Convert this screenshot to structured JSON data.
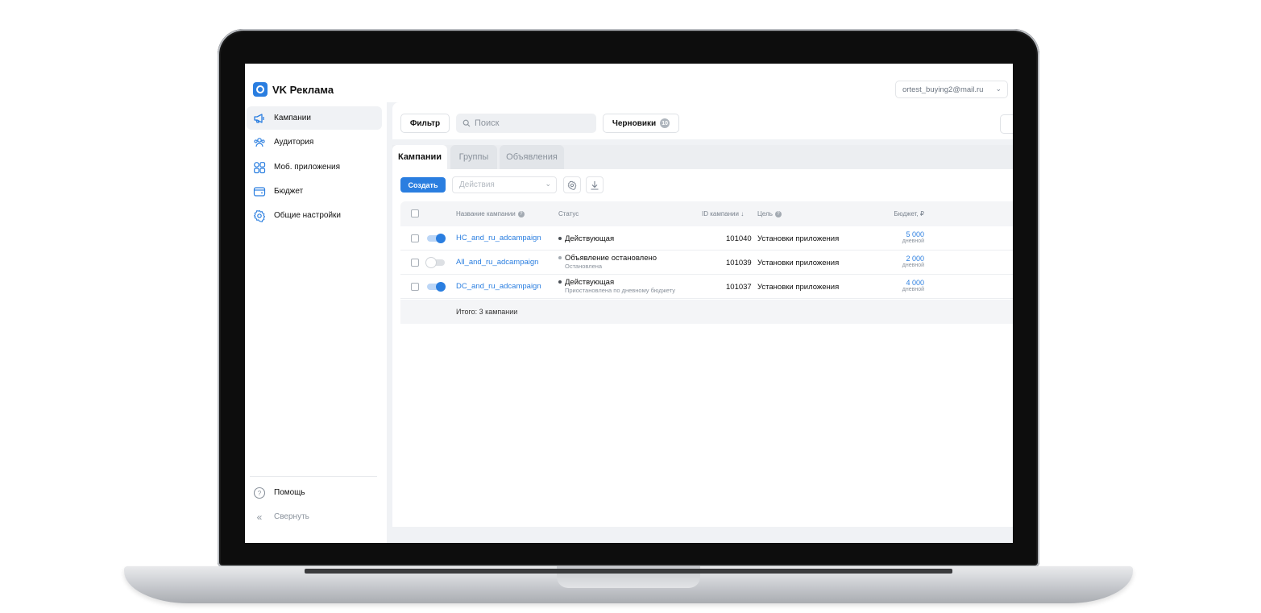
{
  "app": {
    "logo_text": "VK Реклама",
    "account_email": "ortest_buying2@mail.ru",
    "accent": "#2a7ee0"
  },
  "sidebar": {
    "items": [
      {
        "label": "Кампании",
        "icon": "megaphone-icon",
        "active": true
      },
      {
        "label": "Аудитория",
        "icon": "audience-icon",
        "active": false
      },
      {
        "label": "Моб. приложения",
        "icon": "apps-grid-icon",
        "active": false
      },
      {
        "label": "Бюджет",
        "icon": "wallet-icon",
        "active": false
      },
      {
        "label": "Общие настройки",
        "icon": "gear-icon",
        "active": false
      }
    ],
    "help_label": "Помощь",
    "collapse_label": "Свернуть"
  },
  "filterbar": {
    "filter_label": "Фильтр",
    "search_placeholder": "Поиск",
    "drafts_label": "Черновики",
    "drafts_count": "10"
  },
  "tabs": [
    {
      "label": "Кампании",
      "active": true
    },
    {
      "label": "Группы",
      "active": false
    },
    {
      "label": "Объявления",
      "active": false
    }
  ],
  "toolbar": {
    "create_label": "Создать",
    "actions_placeholder": "Действия"
  },
  "table": {
    "columns": {
      "name": "Название кампании",
      "status": "Статус",
      "id": "ID кампании ↓",
      "goal": "Цель",
      "budget": "Бюджет, ₽"
    },
    "rows": [
      {
        "enabled": true,
        "name": "HC_and_ru_adcampaign",
        "status": "Действующая",
        "status_sub": "",
        "status_color": "#4a4f55",
        "id": "101040",
        "goal": "Установки приложения",
        "budget": "5 000",
        "budget_period": "дневной"
      },
      {
        "enabled": false,
        "name": "All_and_ru_adcampaign",
        "status": "Объявление остановлено",
        "status_sub": "Остановлена",
        "status_color": "#a3aab2",
        "id": "101039",
        "goal": "Установки приложения",
        "budget": "2 000",
        "budget_period": "дневной"
      },
      {
        "enabled": true,
        "name": "DC_and_ru_adcampaign",
        "status": "Действующая",
        "status_sub": "Приостановлена по дневному бюджету",
        "status_color": "#4a4f55",
        "id": "101037",
        "goal": "Установки приложения",
        "budget": "4 000",
        "budget_period": "дневной"
      }
    ],
    "total": "Итого: 3 кампании"
  }
}
